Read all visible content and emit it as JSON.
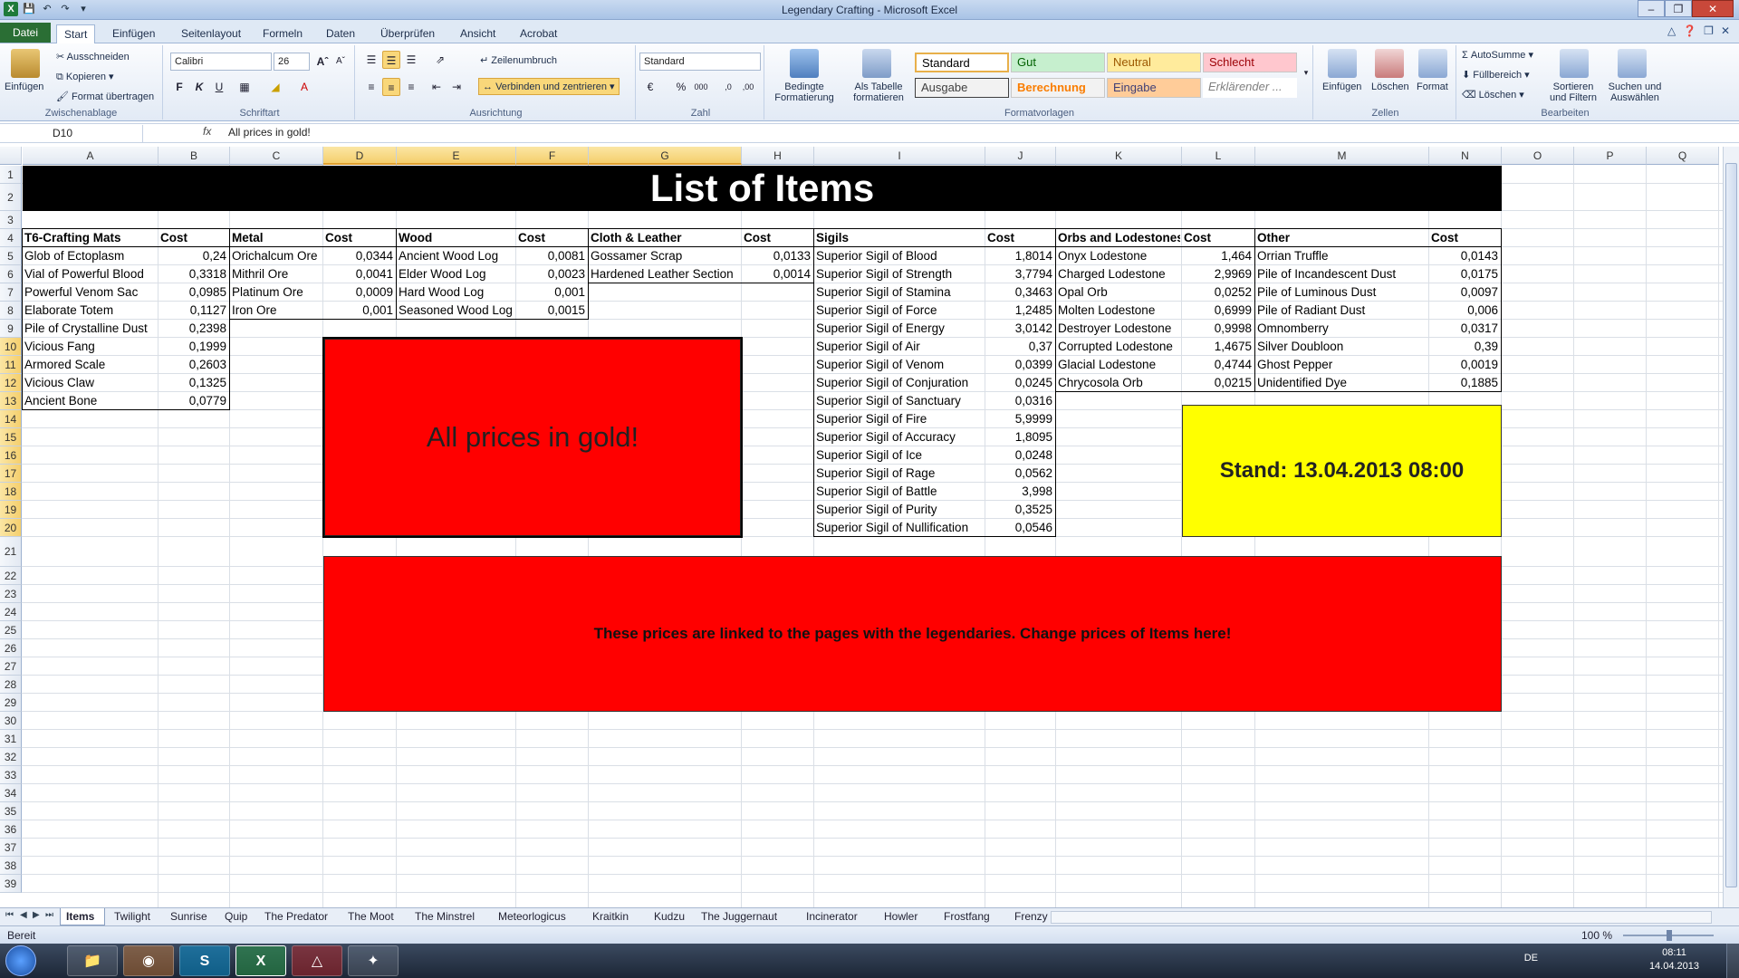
{
  "window": {
    "title": "Legendary Crafting  -  Microsoft Excel",
    "colors": {
      "file_tab": "#2a6e34",
      "title_bar": "#c9daf0"
    }
  },
  "ribbon_tabs": [
    "Datei",
    "Start",
    "Einfügen",
    "Seitenlayout",
    "Formeln",
    "Daten",
    "Überprüfen",
    "Ansicht",
    "Acrobat"
  ],
  "ribbon": {
    "clipboard": {
      "paste": "Einfügen",
      "cut": "Ausschneiden",
      "copy": "Kopieren",
      "format_painter": "Format übertragen",
      "label": "Zwischenablage"
    },
    "font": {
      "name": "Calibri",
      "size": "26",
      "label": "Schriftart"
    },
    "alignment": {
      "wrap": "Zeilenumbruch",
      "merge": "Verbinden und zentrieren",
      "label": "Ausrichtung"
    },
    "number": {
      "format": "Standard",
      "label": "Zahl"
    },
    "styles": {
      "cond_format": "Bedingte Formatierung",
      "as_table": "Als Tabelle formatieren",
      "label": "Formatvorlagen",
      "items": [
        {
          "name": "Standard",
          "bg": "#ffffff",
          "fg": "#000000"
        },
        {
          "name": "Gut",
          "bg": "#c6efce",
          "fg": "#006100"
        },
        {
          "name": "Neutral",
          "bg": "#ffeb9c",
          "fg": "#9c5700"
        },
        {
          "name": "Schlecht",
          "bg": "#ffc7ce",
          "fg": "#9c0006"
        },
        {
          "name": "Ausgabe",
          "bg": "#f2f2f2",
          "fg": "#3f3f3f"
        },
        {
          "name": "Berechnung",
          "bg": "#f2f2f2",
          "fg": "#fa7d00"
        },
        {
          "name": "Eingabe",
          "bg": "#ffcc99",
          "fg": "#3f3f76"
        },
        {
          "name": "Erklärender ...",
          "bg": "#ffffff",
          "fg": "#7f7f7f"
        }
      ]
    },
    "cells": {
      "insert": "Einfügen",
      "delete": "Löschen",
      "format": "Format",
      "label": "Zellen"
    },
    "editing": {
      "autosum": "AutoSumme",
      "fill": "Füllbereich",
      "clear": "Löschen",
      "sort": "Sortieren und Filtern",
      "find": "Suchen und Auswählen",
      "label": "Bearbeiten"
    }
  },
  "formula_bar": {
    "name_box": "D10",
    "fx": "fx",
    "content": "All prices in gold!"
  },
  "columns": [
    "A",
    "B",
    "C",
    "D",
    "E",
    "F",
    "G",
    "H",
    "I",
    "J",
    "K",
    "L",
    "M",
    "N",
    "O",
    "P",
    "Q"
  ],
  "selected_columns": [
    "D",
    "E",
    "F",
    "G"
  ],
  "rows": [
    "1",
    "2",
    "3",
    "4",
    "5",
    "6",
    "7",
    "8",
    "9",
    "10",
    "11",
    "12",
    "13",
    "14",
    "15",
    "16",
    "17",
    "18",
    "19",
    "20",
    "21",
    "22",
    "23",
    "24",
    "25",
    "26",
    "27",
    "28",
    "29",
    "30",
    "31",
    "32",
    "33",
    "34",
    "35",
    "36",
    "37",
    "38",
    "39"
  ],
  "selected_rows": [
    "10",
    "11",
    "12",
    "13",
    "14",
    "15",
    "16",
    "17",
    "18",
    "19",
    "20"
  ],
  "sheet": {
    "title": "List of Items",
    "price_note": "All prices in gold!",
    "stand": "Stand: 13.04.2013  08:00",
    "linked_note": "These prices are linked to the pages with the legendaries. Change prices of Items here!",
    "tables": [
      {
        "header": "T6-Crafting Mats",
        "cost": "Cost",
        "rows": [
          [
            "Glob of Ectoplasm",
            "0,24"
          ],
          [
            "Vial of Powerful Blood",
            "0,3318"
          ],
          [
            "Powerful Venom Sac",
            "0,0985"
          ],
          [
            "Elaborate Totem",
            "0,1127"
          ],
          [
            "Pile of Crystalline Dust",
            "0,2398"
          ],
          [
            "Vicious Fang",
            "0,1999"
          ],
          [
            "Armored Scale",
            "0,2603"
          ],
          [
            "Vicious Claw",
            "0,1325"
          ],
          [
            "Ancient Bone",
            "0,0779"
          ]
        ]
      },
      {
        "header": "Metal",
        "cost": "Cost",
        "rows": [
          [
            "Orichalcum Ore",
            "0,0344"
          ],
          [
            "Mithril Ore",
            "0,0041"
          ],
          [
            "Platinum Ore",
            "0,0009"
          ],
          [
            "Iron Ore",
            "0,001"
          ]
        ]
      },
      {
        "header": "Wood",
        "cost": "Cost",
        "rows": [
          [
            "Ancient Wood Log",
            "0,0081"
          ],
          [
            "Elder Wood Log",
            "0,0023"
          ],
          [
            "Hard Wood Log",
            "0,001"
          ],
          [
            "Seasoned Wood Log",
            "0,0015"
          ]
        ]
      },
      {
        "header": "Cloth & Leather",
        "cost": "Cost",
        "rows": [
          [
            "Gossamer Scrap",
            "0,0133"
          ],
          [
            "Hardened Leather Section",
            "0,0014"
          ]
        ]
      },
      {
        "header": "Sigils",
        "cost": "Cost",
        "rows": [
          [
            "Superior Sigil of Blood",
            "1,8014"
          ],
          [
            "Superior Sigil of Strength",
            "3,7794"
          ],
          [
            "Superior Sigil of Stamina",
            "0,3463"
          ],
          [
            "Superior Sigil of Force",
            "1,2485"
          ],
          [
            "Superior Sigil of Energy",
            "3,0142"
          ],
          [
            "Superior Sigil of Air",
            "0,37"
          ],
          [
            "Superior Sigil of Venom",
            "0,0399"
          ],
          [
            "Superior Sigil of Conjuration",
            "0,0245"
          ],
          [
            "Superior Sigil of Sanctuary",
            "0,0316"
          ],
          [
            "Superior Sigil of Fire",
            "5,9999"
          ],
          [
            "Superior Sigil of Accuracy",
            "1,8095"
          ],
          [
            "Superior Sigil of Ice",
            "0,0248"
          ],
          [
            "Superior Sigil of Rage",
            "0,0562"
          ],
          [
            "Superior Sigil of Battle",
            "3,998"
          ],
          [
            "Superior Sigil of Purity",
            "0,3525"
          ],
          [
            "Superior Sigil of Nullification",
            "0,0546"
          ]
        ]
      },
      {
        "header": "Orbs and Lodestones",
        "cost": "Cost",
        "rows": [
          [
            "Onyx Lodestone",
            "1,464"
          ],
          [
            "Charged Lodestone",
            "2,9969"
          ],
          [
            "Opal Orb",
            "0,0252"
          ],
          [
            "Molten Lodestone",
            "0,6999"
          ],
          [
            "Destroyer Lodestone",
            "0,9998"
          ],
          [
            "Corrupted Lodestone",
            "1,4675"
          ],
          [
            "Glacial Lodestone",
            "0,4744"
          ],
          [
            "Chrycosola Orb",
            "0,0215"
          ]
        ]
      },
      {
        "header": "Other",
        "cost": "Cost",
        "rows": [
          [
            "Orrian Truffle",
            "0,0143"
          ],
          [
            "Pile of Incandescent Dust",
            "0,0175"
          ],
          [
            "Pile of Luminous Dust",
            "0,0097"
          ],
          [
            "Pile of Radiant Dust",
            "0,006"
          ],
          [
            "Omnomberry",
            "0,0317"
          ],
          [
            "Silver Doubloon",
            "0,39"
          ],
          [
            "Ghost Pepper",
            "0,0019"
          ],
          [
            "Unidentified Dye",
            "0,1885"
          ]
        ]
      }
    ],
    "colors": {
      "banner": "#000000",
      "red": "#ff0000",
      "yellow": "#ffff00"
    }
  },
  "sheet_tabs": [
    "Items",
    "Twilight",
    "Sunrise",
    "Quip",
    "The Predator",
    "The Moot",
    "The Minstrel",
    "Meteorlogicus",
    "Kraitkin",
    "Kudzu",
    "The Juggernaut",
    "Incinerator",
    "Howler",
    "Frostfang",
    "Frenzy"
  ],
  "active_sheet": "Items",
  "status": {
    "ready": "Bereit",
    "zoom": "100 %"
  },
  "taskbar": {
    "lang": "DE",
    "time": "08:11",
    "date": "14.04.2013",
    "apps": [
      "explorer-icon",
      "firefox-icon",
      "skype-icon",
      "excel-icon",
      "acrobat-icon",
      "paint-icon"
    ]
  }
}
